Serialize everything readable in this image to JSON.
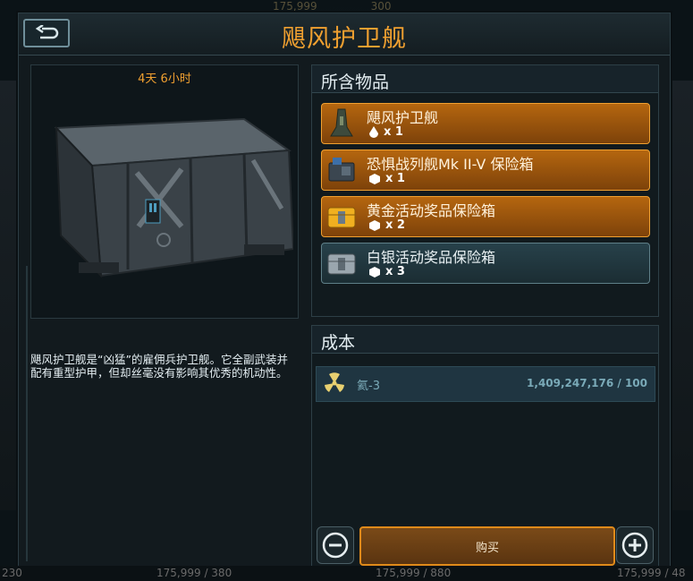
{
  "background": {
    "top_values": [
      "175,999",
      "300"
    ],
    "bottom_values": [
      "230",
      "175,999 / 380",
      "175,999 / 880",
      "175,999 / 48"
    ]
  },
  "dialog": {
    "title": "飓风护卫舰",
    "back_icon": "back-arrow-icon",
    "timer": "4天 6小时",
    "description": "飓风护卫舰是“凶猛”的雇佣兵护卫舰。它全副武装并配有重型护甲，但却丝毫没有影响其优秀的机动性。"
  },
  "contents": {
    "heading": "所含物品",
    "items": [
      {
        "name": "飓风护卫舰",
        "qty": "x 1",
        "qty_icon": "drop-icon",
        "style": "orange"
      },
      {
        "name": "恐惧战列舰Mk II-V 保险箱",
        "qty": "x 1",
        "qty_icon": "crate-icon",
        "style": "orange"
      },
      {
        "name": "黄金活动奖品保险箱",
        "qty": "x 2",
        "qty_icon": "crate-icon",
        "style": "orange"
      },
      {
        "name": "白银活动奖品保险箱",
        "qty": "x 3",
        "qty_icon": "crate-icon",
        "style": "silver"
      }
    ]
  },
  "cost": {
    "heading": "成本",
    "resource_name": "氦-3",
    "resource_icon": "radiation-icon",
    "resource_value": "1,409,247,176 / 100"
  },
  "buy": {
    "label": "购买",
    "minus_icon": "minus-icon",
    "plus_icon": "plus-icon"
  },
  "colors": {
    "accent": "#f0a030",
    "panel": "#111a1e",
    "silver_item": "#27414a"
  }
}
